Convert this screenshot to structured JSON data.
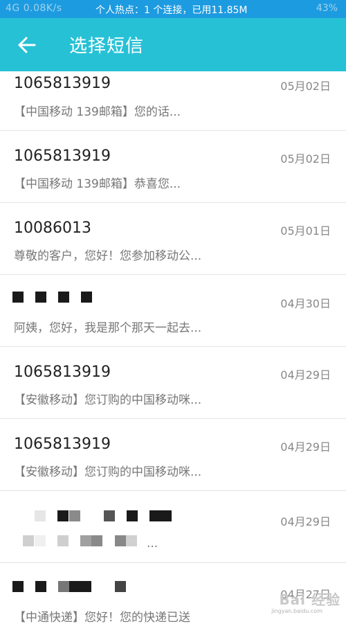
{
  "status_bar": {
    "left": "4G  0.08K/s",
    "center": "个人热点：1 个连接，已用11.85M",
    "right": "43%"
  },
  "app_bar": {
    "title": "选择短信"
  },
  "messages": [
    {
      "sender": "1065813919",
      "date": "05月02日",
      "preview": "【中国移动 139邮箱】您的话..."
    },
    {
      "sender": "1065813919",
      "date": "05月02日",
      "preview": "【中国移动 139邮箱】恭喜您..."
    },
    {
      "sender": "10086013",
      "date": "05月01日",
      "preview": "尊敬的客户，您好！您参加移动公..."
    },
    {
      "sender": "",
      "date": "04月30日",
      "preview": "阿姨，您好，我是那个那天一起去..."
    },
    {
      "sender": "1065813919",
      "date": "04月29日",
      "preview": "【安徽移动】您订购的中国移动咪..."
    },
    {
      "sender": "1065813919",
      "date": "04月29日",
      "preview": "【安徽移动】您订购的中国移动咪..."
    },
    {
      "sender": "",
      "date": "04月29日",
      "preview": "..."
    },
    {
      "sender": "",
      "date": "04月27日",
      "preview": "【中通快递】您好！您的快递已送"
    }
  ],
  "watermark": {
    "text": "Bai 经验",
    "sub": "jingyan.baidu.com"
  },
  "colors": {
    "app_bar": "#27c1d6",
    "status_bar": "#1d9be0"
  }
}
